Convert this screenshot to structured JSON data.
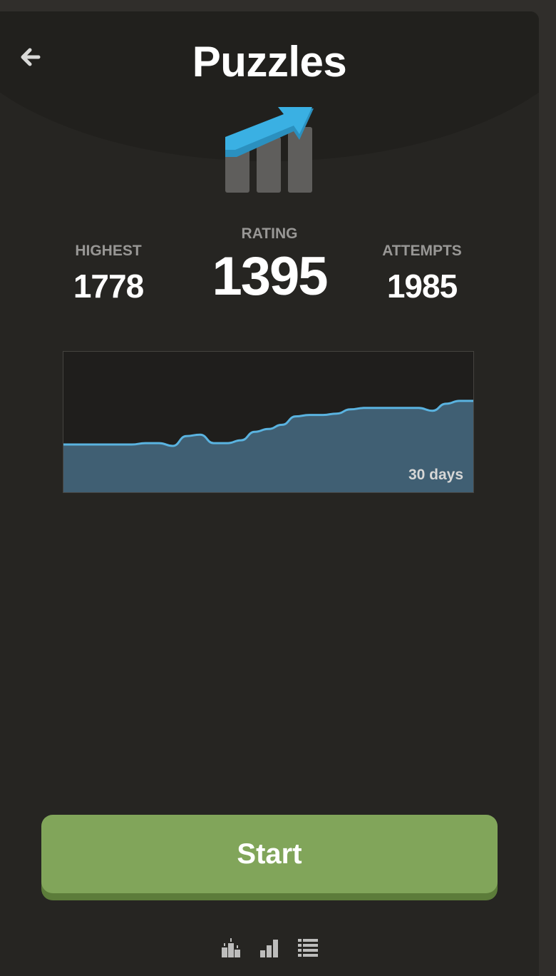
{
  "header": {
    "title": "Puzzles",
    "back_icon": "arrow-left-icon",
    "logo_icon": "rating-trend-up-icon"
  },
  "stats": {
    "highest": {
      "label": "HIGHEST",
      "value": "1778"
    },
    "rating": {
      "label": "RATING",
      "value": "1395"
    },
    "attempts": {
      "label": "ATTEMPTS",
      "value": "1985"
    }
  },
  "chart_data": {
    "type": "area",
    "title": "",
    "annotation": "30 days",
    "x": [
      0,
      1,
      2,
      3,
      4,
      5,
      6,
      7,
      8,
      9,
      10,
      11,
      12,
      13,
      14,
      15,
      16,
      17,
      18,
      19,
      20,
      21,
      22,
      23,
      24,
      25,
      26,
      27,
      28,
      29,
      30
    ],
    "values": [
      0.34,
      0.34,
      0.34,
      0.34,
      0.34,
      0.34,
      0.35,
      0.35,
      0.33,
      0.4,
      0.41,
      0.35,
      0.35,
      0.37,
      0.43,
      0.45,
      0.48,
      0.54,
      0.55,
      0.55,
      0.56,
      0.59,
      0.6,
      0.6,
      0.6,
      0.6,
      0.6,
      0.58,
      0.63,
      0.65,
      0.65
    ],
    "ylim": [
      0,
      1
    ],
    "grid": false,
    "colors": {
      "line": "#5ab3e0",
      "fill": "#405f73",
      "background": "#1f1e1c"
    }
  },
  "actions": {
    "start_label": "Start"
  },
  "footer": {
    "icons": [
      "leaderboard-icon",
      "stats-bars-icon",
      "list-icon"
    ]
  },
  "colors": {
    "background": "#262522",
    "accent_green": "#81a55a",
    "accent_blue": "#2ea7d8"
  }
}
